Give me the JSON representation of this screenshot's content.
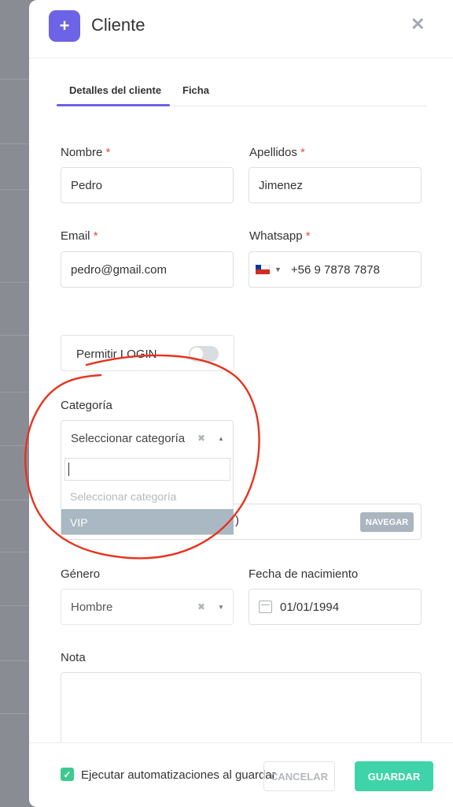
{
  "modal": {
    "title": "Cliente"
  },
  "tabs": [
    {
      "label": "Detalles del cliente",
      "active": true
    },
    {
      "label": "Ficha",
      "active": false
    }
  ],
  "fields": {
    "nombre": {
      "label": "Nombre",
      "value": "Pedro"
    },
    "apellidos": {
      "label": "Apellidos",
      "value": "Jimenez"
    },
    "email": {
      "label": "Email",
      "value": "pedro@gmail.com"
    },
    "whatsapp": {
      "label": "Whatsapp",
      "value": "+56  9 7878 7878"
    },
    "required_mark": "*"
  },
  "login": {
    "label": "Permitir LOGIN",
    "enabled": false
  },
  "categoria": {
    "label": "Categoría",
    "selected_placeholder": "Seleccionar categoría",
    "options": [
      {
        "label": "Seleccionar categoría",
        "placeholder": true
      },
      {
        "label": "VIP",
        "highlighted": true
      }
    ]
  },
  "navegar": {
    "button": "NAVEGAR",
    "partial_value": ")"
  },
  "genero": {
    "label": "Género",
    "value": "Hombre"
  },
  "fecha": {
    "label": "Fecha de nacimiento",
    "value": "01/01/1994"
  },
  "nota": {
    "label": "Nota",
    "value": ""
  },
  "footer": {
    "checkbox_label": "Ejecutar automatizaciones al guardar",
    "checked": true,
    "cancel": "CANCELAR",
    "save": "GUARDAR"
  },
  "icons": {
    "plus": "+",
    "close": "✕",
    "clear": "✖",
    "caret_up": "▲",
    "caret_down": "▼",
    "check": "✓",
    "small_caret": "▼"
  },
  "colors": {
    "accent": "#6d63e6",
    "save": "#3fd3a9",
    "annotation": "#e8321e",
    "highlight": "#a9b8c2"
  }
}
